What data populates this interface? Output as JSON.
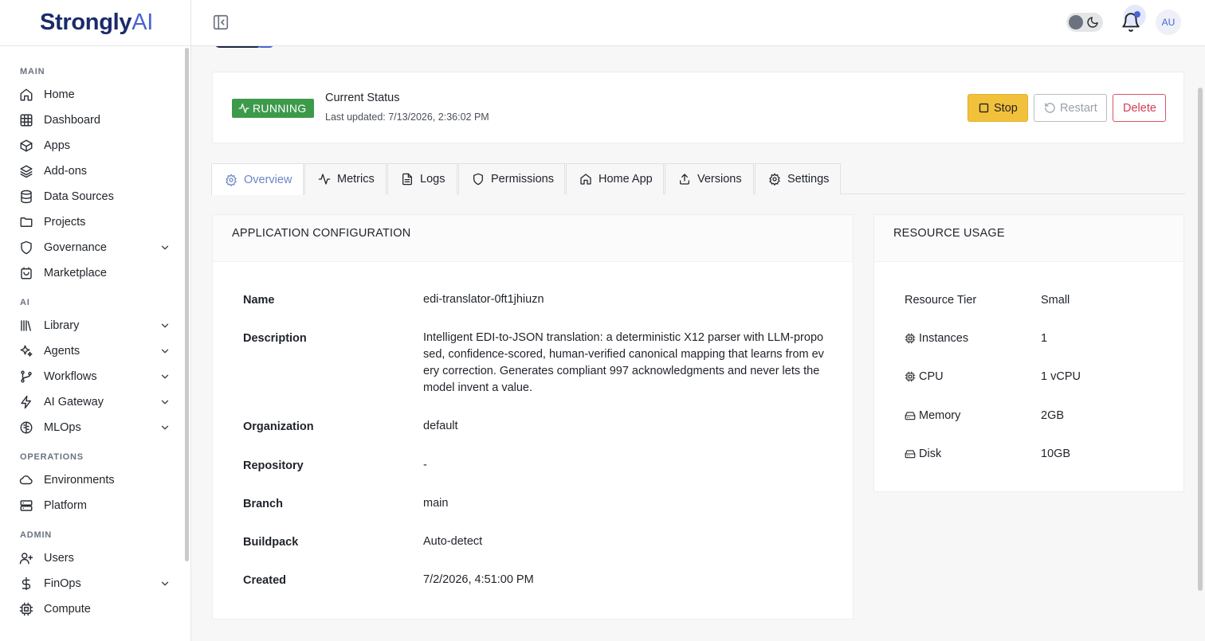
{
  "brand": {
    "name_bold": "Strongly",
    "name_light": "AI"
  },
  "sidebar": {
    "sections": [
      {
        "label": "MAIN",
        "items": [
          {
            "label": "Home",
            "icon": "home-icon"
          },
          {
            "label": "Dashboard",
            "icon": "grid-icon"
          },
          {
            "label": "Apps",
            "icon": "box-icon"
          },
          {
            "label": "Add-ons",
            "icon": "layers-icon"
          },
          {
            "label": "Data Sources",
            "icon": "database-icon"
          },
          {
            "label": "Projects",
            "icon": "folder-icon"
          },
          {
            "label": "Governance",
            "icon": "shield-icon",
            "expandable": true
          },
          {
            "label": "Marketplace",
            "icon": "store-icon"
          }
        ]
      },
      {
        "label": "AI",
        "items": [
          {
            "label": "Library",
            "icon": "library-icon",
            "expandable": true
          },
          {
            "label": "Agents",
            "icon": "sparkles-icon",
            "expandable": true
          },
          {
            "label": "Workflows",
            "icon": "workflow-icon",
            "expandable": true
          },
          {
            "label": "AI Gateway",
            "icon": "zap-icon",
            "expandable": true
          },
          {
            "label": "MLOps",
            "icon": "brain-icon",
            "expandable": true
          }
        ]
      },
      {
        "label": "OPERATIONS",
        "items": [
          {
            "label": "Environments",
            "icon": "cloud-icon"
          },
          {
            "label": "Platform",
            "icon": "server-icon"
          }
        ]
      },
      {
        "label": "ADMIN",
        "items": [
          {
            "label": "Users",
            "icon": "user-plus-icon"
          },
          {
            "label": "FinOps",
            "icon": "dollar-icon",
            "expandable": true
          },
          {
            "label": "Compute",
            "icon": "cpu-icon"
          }
        ]
      }
    ]
  },
  "topbar": {
    "avatar_initials": "AU"
  },
  "status": {
    "badge": "RUNNING",
    "title": "Current Status",
    "updated": "Last updated: 7/13/2026, 2:36:02 PM",
    "stop_label": "Stop",
    "restart_label": "Restart",
    "delete_label": "Delete",
    "badge_color": "#3d9a4b",
    "stop_color": "#f2c13b"
  },
  "tabs": [
    {
      "label": "Overview",
      "icon": "gear-icon",
      "active": true
    },
    {
      "label": "Metrics",
      "icon": "activity-icon"
    },
    {
      "label": "Logs",
      "icon": "file-icon"
    },
    {
      "label": "Permissions",
      "icon": "shield-icon"
    },
    {
      "label": "Home App",
      "icon": "home-icon"
    },
    {
      "label": "Versions",
      "icon": "upload-icon"
    },
    {
      "label": "Settings",
      "icon": "gear-icon"
    }
  ],
  "config": {
    "title": "APPLICATION CONFIGURATION",
    "rows": [
      {
        "label": "Name",
        "value": "edi-translator-0ft1jhiuzn"
      },
      {
        "label": "Description",
        "value": "Intelligent EDI-to-JSON translation: a deterministic X12 parser with LLM-proposed, confidence-scored, human-verified canonical mapping that learns from every correction. Generates compliant 997 acknowledgments and never lets the model invent a value."
      },
      {
        "label": "Organization",
        "value": "default"
      },
      {
        "label": "Repository",
        "value": "-"
      },
      {
        "label": "Branch",
        "value": "main"
      },
      {
        "label": "Buildpack",
        "value": "Auto-detect"
      },
      {
        "label": "Created",
        "value": "7/2/2026, 4:51:00 PM"
      }
    ]
  },
  "usage": {
    "title": "RESOURCE USAGE",
    "rows": [
      {
        "label": "Resource Tier",
        "value": "Small",
        "icon": ""
      },
      {
        "label": "Instances",
        "value": "1",
        "icon": "cpu-icon"
      },
      {
        "label": "CPU",
        "value": "1 vCPU",
        "icon": "cpu-icon"
      },
      {
        "label": "Memory",
        "value": "2GB",
        "icon": "harddrive-icon"
      },
      {
        "label": "Disk",
        "value": "10GB",
        "icon": "harddrive-icon"
      }
    ]
  }
}
